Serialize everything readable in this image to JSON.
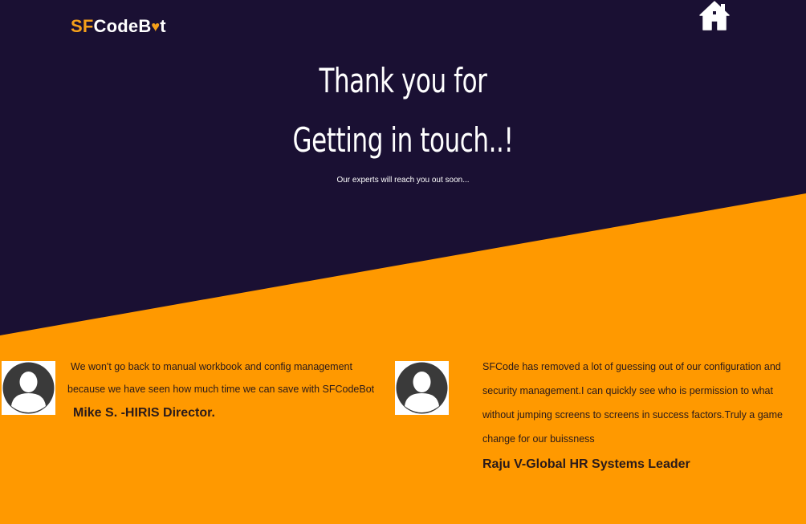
{
  "header": {
    "logo_prefix": "SF",
    "logo_mid": "CodeB",
    "logo_heart": "♥",
    "logo_suffix": "t",
    "home_icon": "home-icon"
  },
  "hero": {
    "line1": "Thank you for",
    "line2": "Getting in touch..!",
    "subtitle": "Our experts will reach you out soon..."
  },
  "colors": {
    "dark_bg": "#1a1033",
    "accent": "#ff9900",
    "logo_accent": "#f5a01a"
  },
  "testimonials": [
    {
      "avatar_icon": "user-avatar-icon",
      "quote_line1": "We won't go back to manual workbook and config management",
      "quote_line2": "because we have seen how much time we can save with SFCodeBot",
      "author": "Mike S. -HIRIS Director."
    },
    {
      "avatar_icon": "user-avatar-icon",
      "quote_line1": "SFCode has removed a lot of guessing out of our configuration and",
      "quote_line2": "security management.I can quickly see who is permission to what",
      "quote_line3": "without jumping screens to screens in success factors.Truly a game",
      "quote_line4": "change for our buissness",
      "author": "Raju V-Global HR Systems Leader"
    }
  ]
}
